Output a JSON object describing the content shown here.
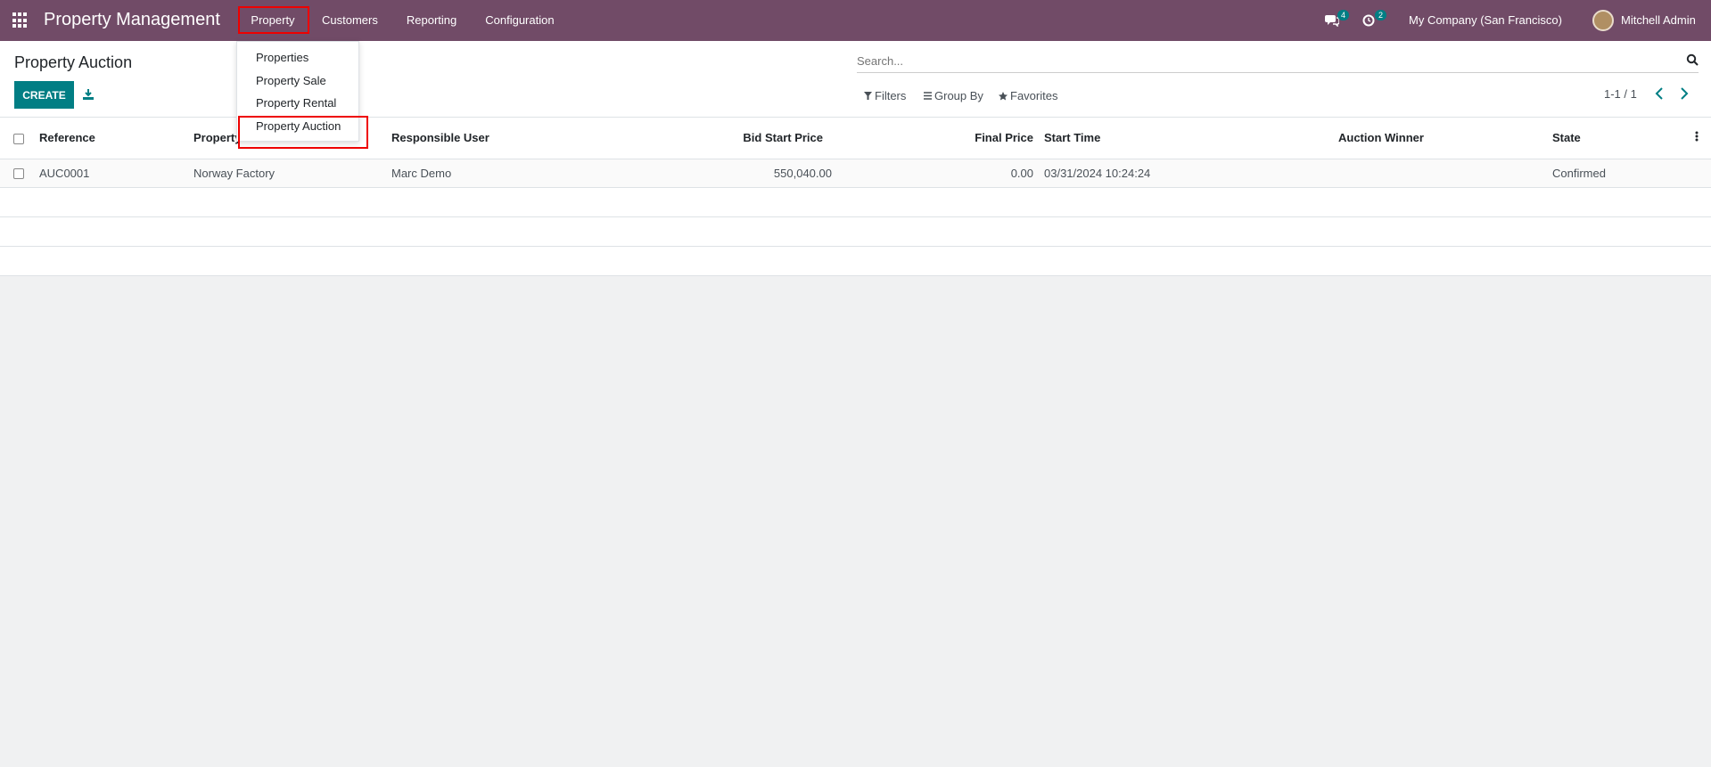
{
  "navbar": {
    "brand": "Property Management",
    "menu": [
      "Property",
      "Customers",
      "Reporting",
      "Configuration"
    ],
    "messages_count": "4",
    "activities_count": "2",
    "company": "My Company (San Francisco)",
    "user": "Mitchell Admin",
    "bg_color": "#714b67"
  },
  "dropdown": {
    "items": [
      "Properties",
      "Property Sale",
      "Property Rental",
      "Property Auction"
    ]
  },
  "control_panel": {
    "title": "Property Auction",
    "create_label": "CREATE",
    "search_placeholder": "Search...",
    "filters_label": "Filters",
    "groupby_label": "Group By",
    "favorites_label": "Favorites",
    "pager": "1-1 / 1"
  },
  "table": {
    "columns": [
      "Reference",
      "Property",
      "Responsible User",
      "Bid Start Price",
      "Final Price",
      "Start Time",
      "Auction Winner",
      "State"
    ],
    "rows": [
      {
        "reference": "AUC0001",
        "property": "Norway Factory",
        "responsible_user": "Marc Demo",
        "bid_start_price": "550,040.00",
        "final_price": "0.00",
        "start_time": "03/31/2024 10:24:24",
        "auction_winner": "",
        "state": "Confirmed"
      }
    ]
  },
  "colors": {
    "primary": "#017e84",
    "highlight": "#ee0000"
  }
}
